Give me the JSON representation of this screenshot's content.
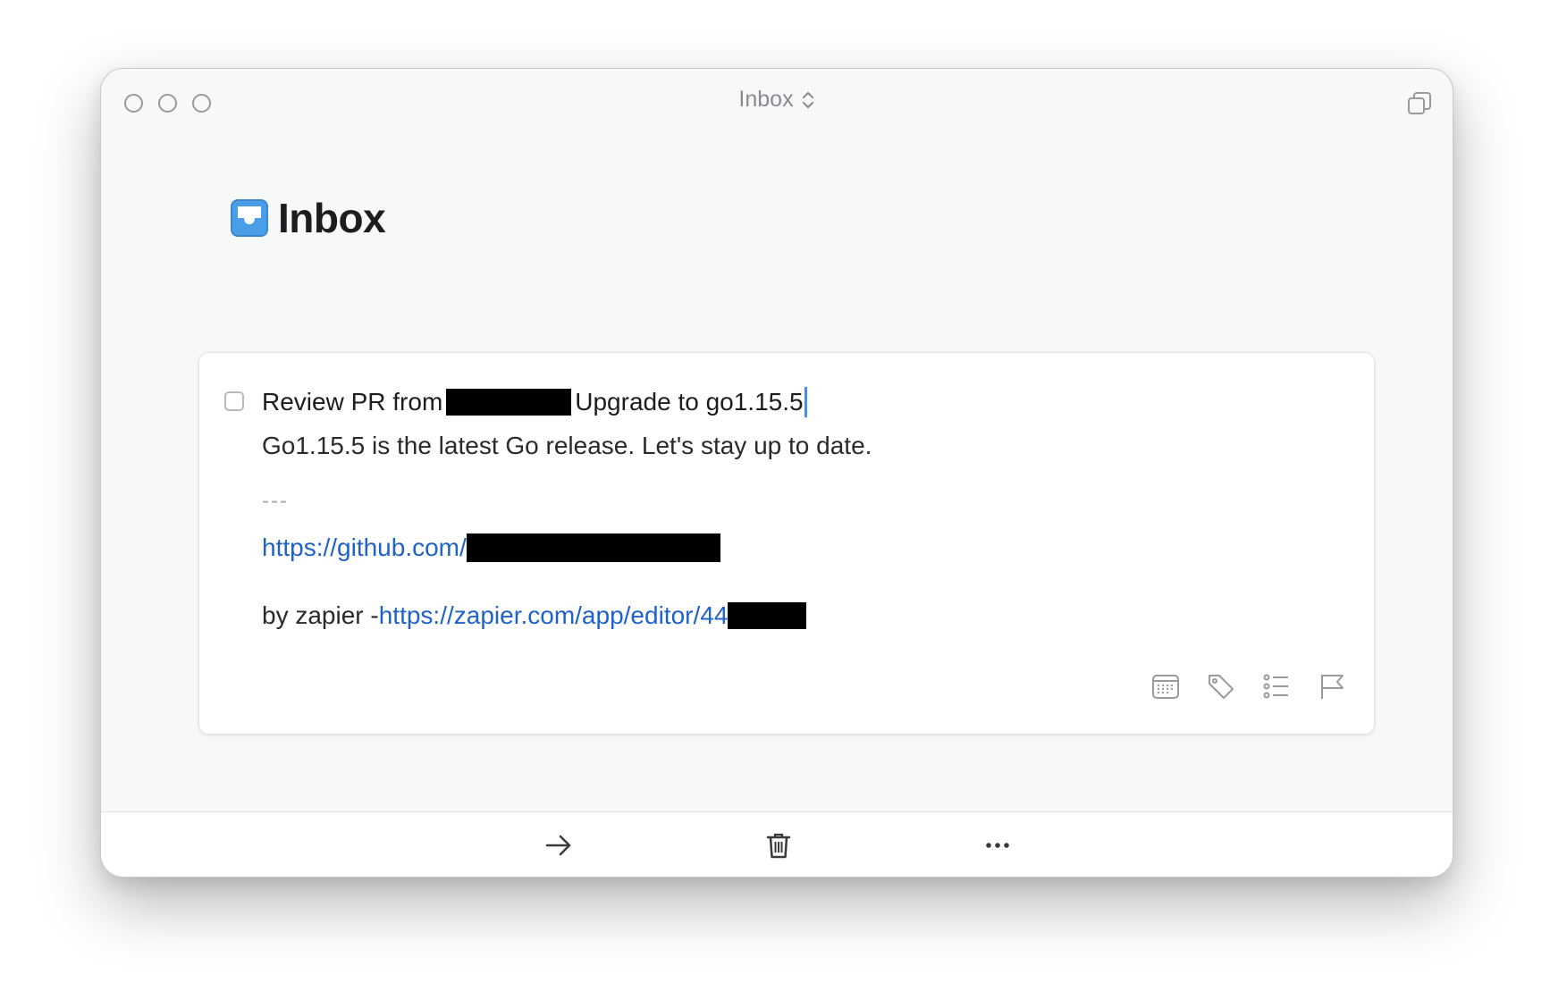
{
  "window": {
    "title": "Inbox",
    "icons": [
      "circle-close",
      "circle-minimize",
      "circle-zoom",
      "chevron-updown-icon",
      "duplicate-window-icon"
    ]
  },
  "header": {
    "icon": "inbox-tray-icon",
    "accent": "#4a9ee8",
    "title": "Inbox"
  },
  "task": {
    "title_prefix": "Review PR from ",
    "title_suffix": "Upgrade to go1.15.5",
    "note_line1": "Go1.15.5 is the latest Go release.  Let's stay up to date.",
    "separator": "---",
    "github_link": "https://github.com/",
    "by_prefix": "by zapier - ",
    "zapier_link": "https://zapier.com/app/editor/44",
    "actions": [
      "calendar-icon",
      "tag-icon",
      "checklist-icon",
      "flag-icon"
    ],
    "link_color": "#1f62c9"
  },
  "toolbar": {
    "icons": [
      "move-arrow-icon",
      "trash-icon",
      "more-icon"
    ]
  }
}
